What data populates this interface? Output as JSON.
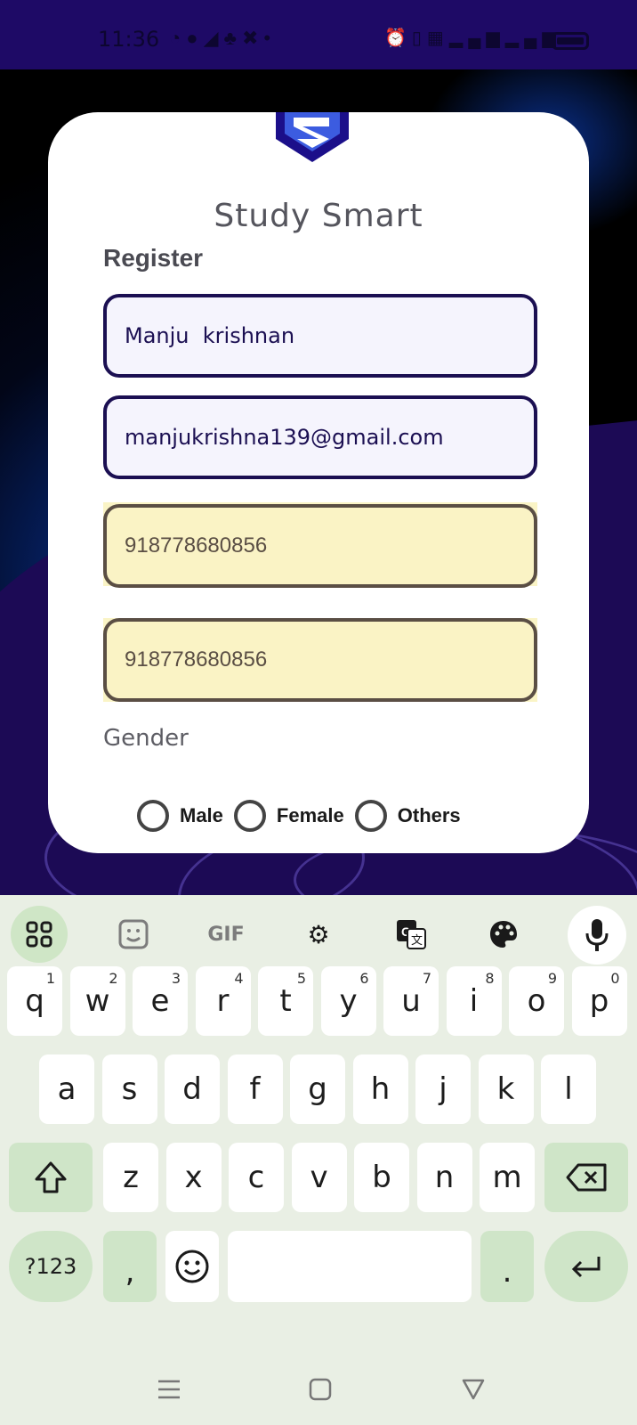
{
  "status_bar": {
    "time": "11:36",
    "left_icons": [
      "whatsapp-icon",
      "chat-icon",
      "telegram-icon",
      "teams-icon",
      "app-icon",
      "dot-icon"
    ],
    "right_icons": [
      "alarm-icon",
      "vibrate-icon",
      "volte-icon",
      "signal-icon",
      "signal2-icon",
      "battery-icon"
    ]
  },
  "app": {
    "title": "Study Smart",
    "register_title": "Register"
  },
  "form": {
    "name_value": "Manju  krishnan",
    "email_value": "manjukrishna139@gmail.com",
    "phone_value": "918778680856",
    "phone_confirm_value": "918778680856",
    "gender_label": "Gender",
    "gender_options": [
      "Male",
      "Female",
      "Others"
    ]
  },
  "keyboard": {
    "toolbar": [
      "grid-icon",
      "sticker-icon",
      "GIF",
      "settings-icon",
      "translate-icon",
      "palette-icon",
      "mic-icon"
    ],
    "row1": [
      {
        "key": "q",
        "hint": "1"
      },
      {
        "key": "w",
        "hint": "2"
      },
      {
        "key": "e",
        "hint": "3"
      },
      {
        "key": "r",
        "hint": "4"
      },
      {
        "key": "t",
        "hint": "5"
      },
      {
        "key": "y",
        "hint": "6"
      },
      {
        "key": "u",
        "hint": "7"
      },
      {
        "key": "i",
        "hint": "8"
      },
      {
        "key": "o",
        "hint": "9"
      },
      {
        "key": "p",
        "hint": "0"
      }
    ],
    "row2": [
      "a",
      "s",
      "d",
      "f",
      "g",
      "h",
      "j",
      "k",
      "l"
    ],
    "row3": [
      "z",
      "x",
      "c",
      "v",
      "b",
      "n",
      "m"
    ],
    "symbols_label": "?123",
    "comma_label": ",",
    "period_label": ".",
    "colors": {
      "background": "#e9efe4",
      "key": "#ffffff",
      "special_key": "#cfe5c8"
    }
  },
  "colors": {
    "status_bar": "#1e0a66",
    "field_border": "#1b0f52",
    "autofill_bg": "#faf3c5"
  }
}
